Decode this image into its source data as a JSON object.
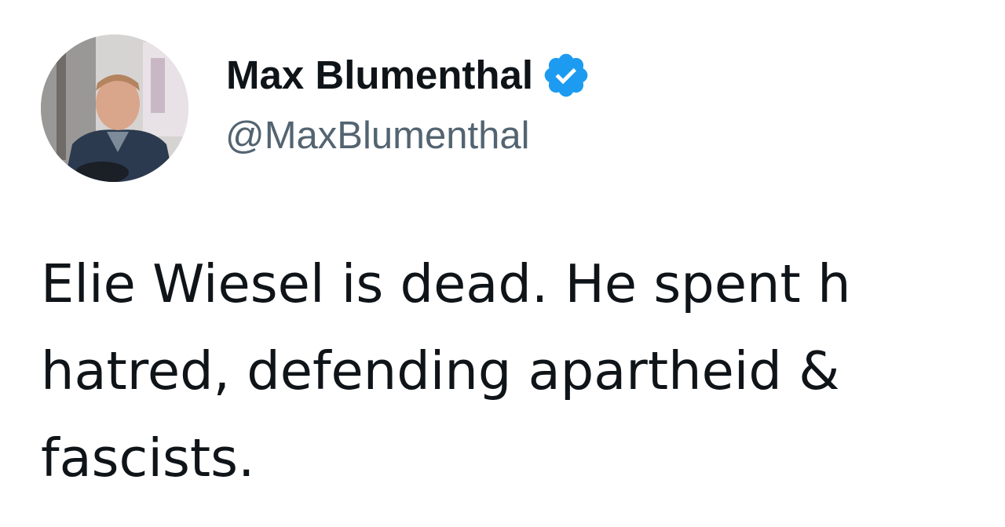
{
  "author": {
    "name": "Max Blumenthal",
    "handle": "@MaxBlumenthal",
    "verified": true,
    "verified_color": "#1d9bf0"
  },
  "avatar": {
    "icon": "profile-photo"
  },
  "tweet": {
    "lines": [
      "Elie Wiesel is dead. He spent h",
      "hatred, defending apartheid &",
      "fascists."
    ]
  },
  "colors": {
    "text": "#0f1419",
    "secondary_text": "#536471",
    "background": "#ffffff"
  }
}
